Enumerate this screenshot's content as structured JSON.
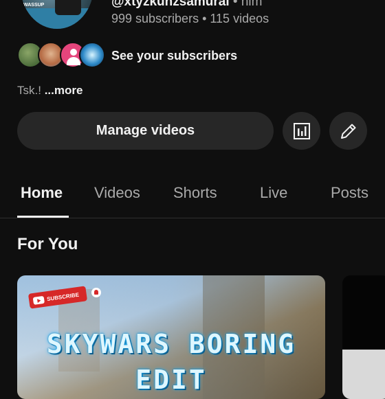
{
  "channel": {
    "avatar_text": "WASSUP",
    "handle": "@xtyzkunzsamurai",
    "handle_suffix": "• him",
    "stats": "999 subscribers • 115 videos",
    "see_subscribers": "See your subscribers",
    "description": "Tsk.!",
    "more_label": "...more"
  },
  "actions": {
    "manage_videos": "Manage videos",
    "analytics_icon": "bar-chart-icon",
    "edit_icon": "pencil-icon"
  },
  "tabs": [
    {
      "label": "Home",
      "active": true
    },
    {
      "label": "Videos",
      "active": false
    },
    {
      "label": "Shorts",
      "active": false
    },
    {
      "label": "Live",
      "active": false
    },
    {
      "label": "Posts",
      "active": false
    }
  ],
  "section": {
    "title": "For You"
  },
  "video": {
    "subscribe_badge": "SUBSCRIBE",
    "title_line1": "SKYWARS BORING",
    "title_line2": "EDIT"
  },
  "colors": {
    "background": "#0f0f0f",
    "button_bg": "#272727",
    "secondary_text": "#aaaaaa",
    "primary_text": "#f1f1f1"
  }
}
